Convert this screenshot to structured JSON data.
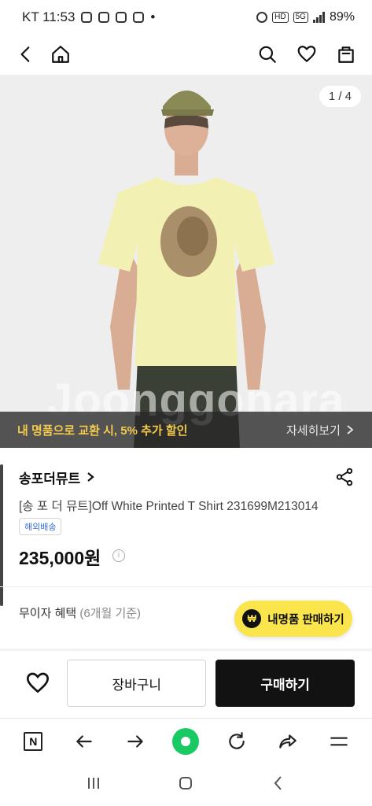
{
  "status_bar": {
    "carrier_time": "KT 11:53",
    "dot": "•",
    "hd": "HD",
    "network": "5G",
    "battery": "89%"
  },
  "product_image": {
    "page_counter": "1 / 4",
    "watermark": "Joonggonara"
  },
  "promo": {
    "text": "내 명품으로 교환 시, 5% 추가 할인",
    "link_label": "자세히보기"
  },
  "product": {
    "brand": "송포더뮤트",
    "title": "[송 포 더 뮤트]Off White Printed T Shirt 231699M213014",
    "shipping_badge": "해외배송",
    "price": "235,000원",
    "installment_label": "무이자 혜택",
    "installment_sub": "(6개월 기준)"
  },
  "sell_button": {
    "icon_text": "₩",
    "label": "내명품 판매하기"
  },
  "actions": {
    "cart_label": "장바구니",
    "buy_label": "구매하기"
  },
  "browser_toolbar": {
    "naver_label": "N"
  },
  "colors": {
    "promo_text": "#f3c94d",
    "sell_button": "#fbe54d",
    "buy_button": "#121212",
    "shipping_badge_text": "#3a6ee0",
    "browser_green": "#18c964"
  }
}
